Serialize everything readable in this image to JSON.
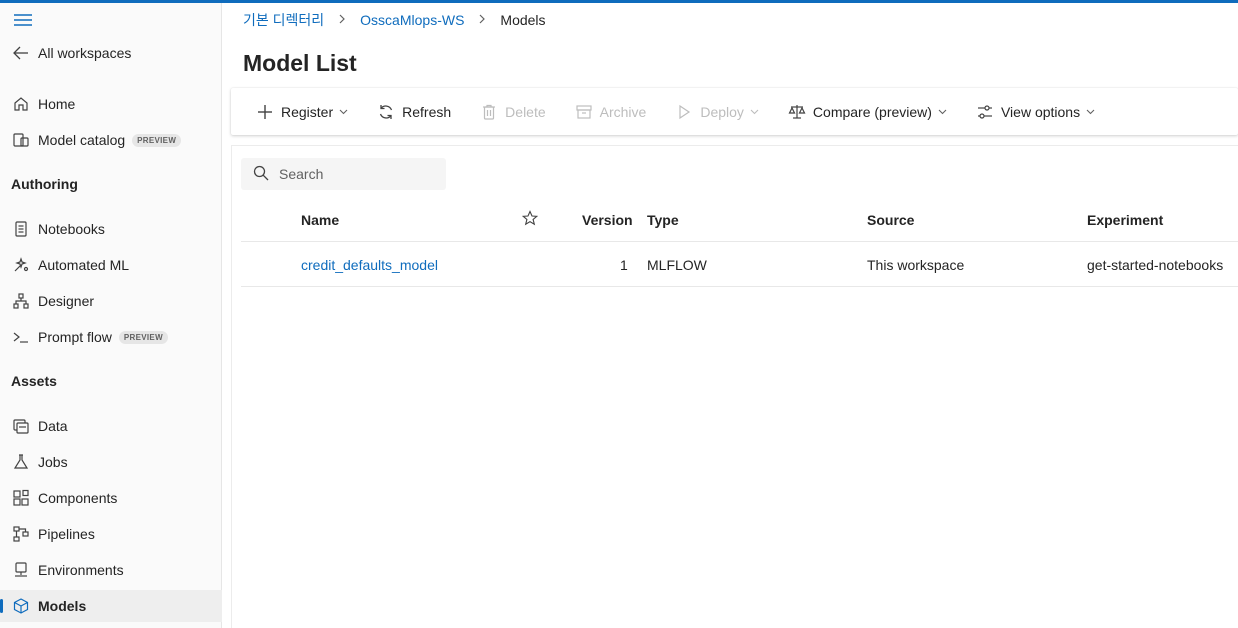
{
  "colors": {
    "accent": "#0f6cbd",
    "text": "#242424",
    "disabled": "#bdbdbd"
  },
  "sidebar": {
    "menu_icon": "hamburger-icon",
    "back": {
      "label": "All workspaces",
      "icon": "arrow-left-icon"
    },
    "home": {
      "label": "Home",
      "icon": "home-icon"
    },
    "catalog": {
      "label": "Model catalog",
      "badge": "PREVIEW",
      "icon": "model-catalog-icon"
    },
    "authoring_header": "Authoring",
    "notebooks": {
      "label": "Notebooks",
      "icon": "notebook-icon"
    },
    "automl": {
      "label": "Automated ML",
      "icon": "automated-ml-icon"
    },
    "designer": {
      "label": "Designer",
      "icon": "designer-icon"
    },
    "promptflow": {
      "label": "Prompt flow",
      "badge": "PREVIEW",
      "icon": "prompt-flow-icon"
    },
    "assets_header": "Assets",
    "data": {
      "label": "Data",
      "icon": "data-icon"
    },
    "jobs": {
      "label": "Jobs",
      "icon": "flask-icon"
    },
    "components": {
      "label": "Components",
      "icon": "components-icon"
    },
    "pipelines": {
      "label": "Pipelines",
      "icon": "pipelines-icon"
    },
    "environments": {
      "label": "Environments",
      "icon": "environment-icon"
    },
    "models": {
      "label": "Models",
      "icon": "cube-icon",
      "active": true
    }
  },
  "breadcrumb": {
    "root": "기본 디렉터리",
    "workspace": "OsscaMlops-WS",
    "current": "Models"
  },
  "page": {
    "title": "Model List"
  },
  "toolbar": {
    "register": "Register",
    "refresh": "Refresh",
    "delete": "Delete",
    "archive": "Archive",
    "deploy": "Deploy",
    "compare": "Compare (preview)",
    "view_options": "View options"
  },
  "search": {
    "placeholder": "Search"
  },
  "table": {
    "columns": {
      "name": "Name",
      "version": "Version",
      "type": "Type",
      "source": "Source",
      "experiment": "Experiment"
    },
    "rows": [
      {
        "name": "credit_defaults_model",
        "version": "1",
        "type": "MLFLOW",
        "source": "This workspace",
        "experiment": "get-started-notebooks"
      }
    ]
  }
}
